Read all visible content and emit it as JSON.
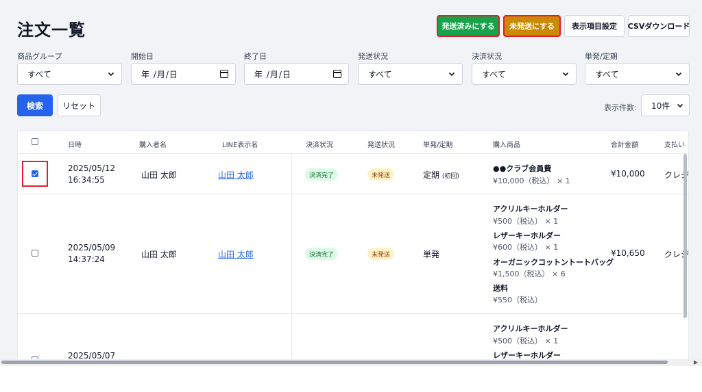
{
  "page": {
    "title": "注文一覧",
    "actions": {
      "mark_shipped": "発送済みにする",
      "mark_unshipped": "未発送にする",
      "column_settings": "表示項目設定",
      "csv_download": "CSVダウンロード"
    }
  },
  "filters": {
    "product_group": {
      "label": "商品グループ",
      "value": "すべて"
    },
    "start_date": {
      "label": "開始日",
      "value": "年 /月/日"
    },
    "end_date": {
      "label": "終了日",
      "value": "年 /月/日"
    },
    "shipping_status": {
      "label": "発送状況",
      "value": "すべて"
    },
    "payment_status": {
      "label": "決済状況",
      "value": "すべて"
    },
    "order_type": {
      "label": "単発/定期",
      "value": "すべて"
    },
    "search_label": "検索",
    "reset_label": "リセット"
  },
  "pagination": {
    "per_page_label": "表示件数:",
    "per_page_value": "10件"
  },
  "table": {
    "headers": {
      "datetime": "日時",
      "buyer": "購入者名",
      "line_name": "LINE表示名",
      "payment": "決済状況",
      "shipping": "発送状況",
      "type": "単発/定期",
      "products": "購入商品",
      "total": "合計金額",
      "pay_method": "支払い"
    },
    "rows": [
      {
        "checked": true,
        "date": "2025/05/12",
        "time": "16:34:55",
        "buyer": "山田 太郎",
        "line_name": "山田 太郎",
        "payment": "決済完了",
        "shipping": "未発送",
        "type": "定期",
        "type_note": "(初回)",
        "products": [
          {
            "name": "●●クラブ会員費",
            "price": "¥10,000（税込）",
            "qty": "× 1"
          }
        ],
        "total": "¥10,000",
        "pay_method": "クレジ"
      },
      {
        "checked": false,
        "date": "2025/05/09",
        "time": "14:37:24",
        "buyer": "山田 太郎",
        "line_name": "山田 太郎",
        "payment": "決済完了",
        "shipping": "未発送",
        "type": "単発",
        "products": [
          {
            "name": "アクリルキーホルダー",
            "price": "¥500（税込）",
            "qty": "× 1"
          },
          {
            "name": "レザーキーホルダー",
            "price": "¥600（税込）",
            "qty": "× 1"
          },
          {
            "name": "オーガニックコットントートバッグ",
            "price": "¥1,500（税込）",
            "qty": "× 6"
          },
          {
            "name": "送料",
            "price": "¥550（税込）",
            "qty": ""
          }
        ],
        "total": "¥10,650",
        "pay_method": "クレジ"
      },
      {
        "checked": false,
        "date": "2025/05/07",
        "time": "",
        "products": [
          {
            "name": "アクリルキーホルダー",
            "price": "¥500（税込）",
            "qty": "× 1"
          },
          {
            "name": "レザーキーホルダー",
            "price": "",
            "qty": ""
          }
        ]
      }
    ]
  },
  "colors": {
    "primary": "#2563eb",
    "shipped_btn": "#16a34a",
    "unshipped_btn": "#ca8a04",
    "highlight": "#e11d2e"
  }
}
